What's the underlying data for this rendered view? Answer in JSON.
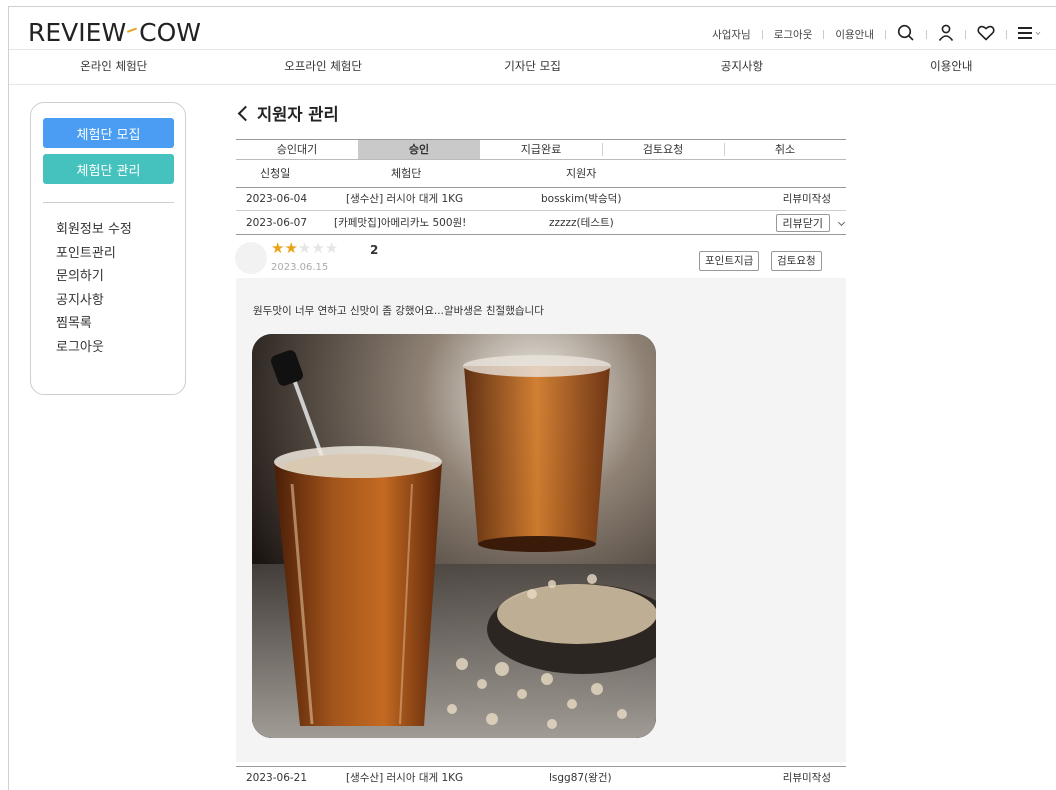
{
  "header": {
    "logo": {
      "left": "REVIEW",
      "right": "COW",
      "accent_color": "#e7a62b"
    },
    "util_links": [
      "사업자님",
      "로그아웃",
      "이용안내"
    ],
    "icons": [
      "search-icon",
      "user-icon",
      "heart-icon",
      "menu-icon"
    ]
  },
  "nav": {
    "items": [
      "온라인 체험단",
      "오프라인 체험단",
      "기자단 모집",
      "공지사항",
      "이용안내"
    ]
  },
  "sidebar": {
    "buttons": [
      {
        "label": "체험단 모집",
        "color": "#4a9df2"
      },
      {
        "label": "체험단 관리",
        "color": "#45c2bd"
      }
    ],
    "menu": [
      "회원정보 수정",
      "포인트관리",
      "문의하기",
      "공지사항",
      "찜목록",
      "로그아웃"
    ]
  },
  "main": {
    "title": "지원자 관리",
    "tabs": [
      "승인대기",
      "승인",
      "지급완료",
      "검토요청",
      "취소"
    ],
    "active_tab": "승인",
    "columns": [
      "신청일",
      "체험단",
      "지원자"
    ],
    "rows": [
      {
        "date": "2023-06-04",
        "campaign": "[생수산] 러시아 대게 1KG",
        "applicant": "bosskim(박승덕)",
        "status": "리뷰미작성"
      },
      {
        "date": "2023-06-07",
        "campaign": "[카페맛집]아메리카노 500원!",
        "applicant": "zzzzz(테스트)",
        "action": "리뷰닫기"
      },
      {
        "date": "2023-06-21",
        "campaign": "[생수산] 러시아 대게 1KG",
        "applicant": "lsgg87(왕건)",
        "status": "리뷰미작성"
      }
    ],
    "review": {
      "rating": 2,
      "max_rating": 5,
      "date": "2023.06.15",
      "text": "원두맛이 너무 연하고 신맛이 좀 강했어요...알바생은 친절했습니다",
      "buttons": [
        "포인트지급",
        "검토요청"
      ],
      "star_color": "#e8a317"
    }
  }
}
